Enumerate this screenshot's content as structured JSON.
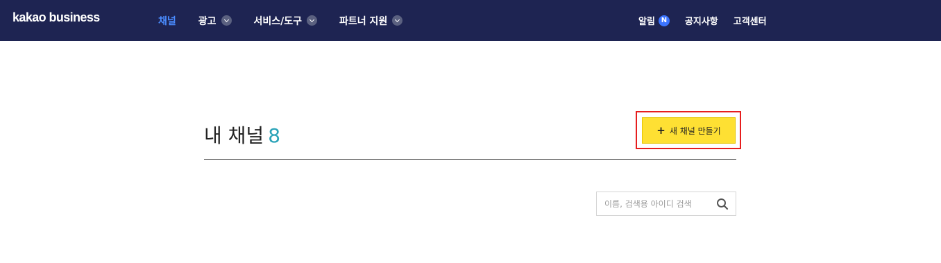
{
  "nav": {
    "logo": "kakao business",
    "menu": [
      {
        "label": "채널",
        "active": true,
        "dropdown": false
      },
      {
        "label": "광고",
        "active": false,
        "dropdown": true
      },
      {
        "label": "서비스/도구",
        "active": false,
        "dropdown": true
      },
      {
        "label": "파트너 지원",
        "active": false,
        "dropdown": true
      }
    ],
    "util": {
      "alerts_label": "알림",
      "alerts_badge": "N",
      "notice_label": "공지사항",
      "support_label": "고객센터"
    }
  },
  "main": {
    "title": "내 채널",
    "count": "8",
    "create_button": {
      "icon": "plus-icon",
      "label": "새 채널 만들기"
    },
    "search": {
      "placeholder": "이름, 검색용 아이디 검색",
      "value": "",
      "icon": "search-icon"
    }
  },
  "colors": {
    "nav_bg": "#1e2452",
    "active_menu": "#4a8cff",
    "count": "#2aa3b8",
    "create_button_bg": "#fee033",
    "highlight_border": "#e61e1e",
    "badge": "#3b74ff"
  }
}
